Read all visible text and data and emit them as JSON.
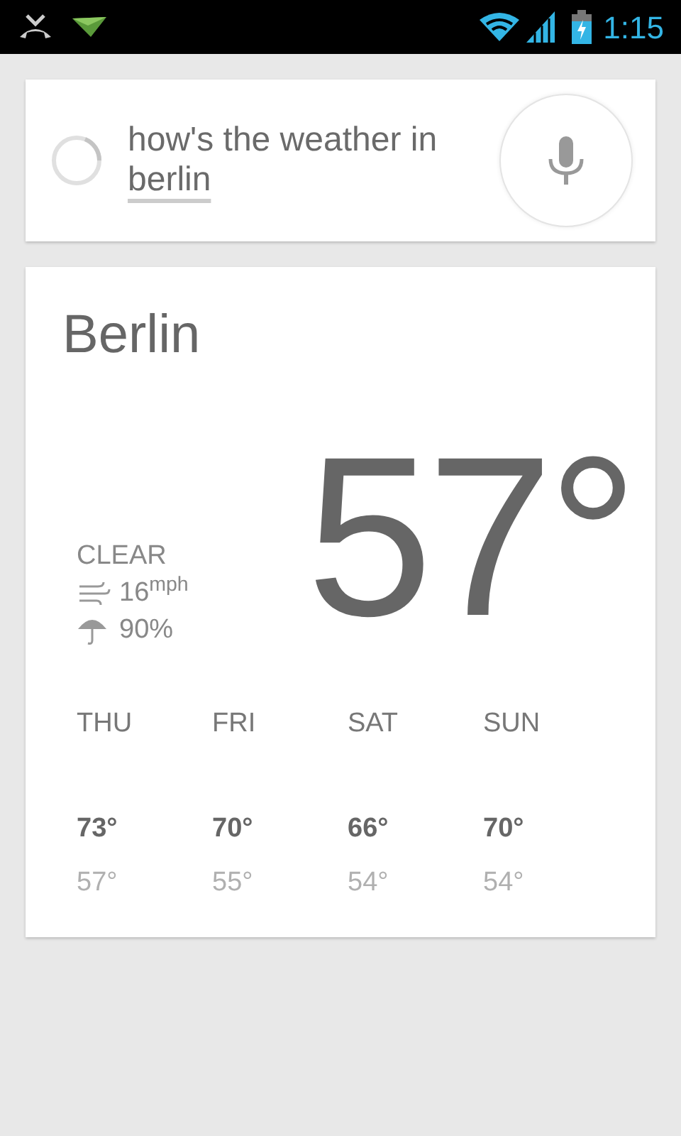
{
  "status_bar": {
    "time": "1:15"
  },
  "search": {
    "query": [
      {
        "text": "how's the weather in",
        "underlined": false
      },
      {
        "text": "berlin",
        "underlined": true
      }
    ]
  },
  "weather": {
    "city": "Berlin",
    "temperature": "57°",
    "condition": "CLEAR",
    "wind": "16$^{mph}$",
    "precipitation": "90%",
    "forecast": [
      {
        "day": "THU",
        "high": "73°",
        "low": "57°"
      },
      {
        "day": "FRI",
        "high": "70°",
        "low": "55°"
      },
      {
        "day": "SAT",
        "high": "66°",
        "low": "54°"
      },
      {
        "day": "SUN",
        "high": "70°",
        "low": "54°"
      }
    ]
  }
}
